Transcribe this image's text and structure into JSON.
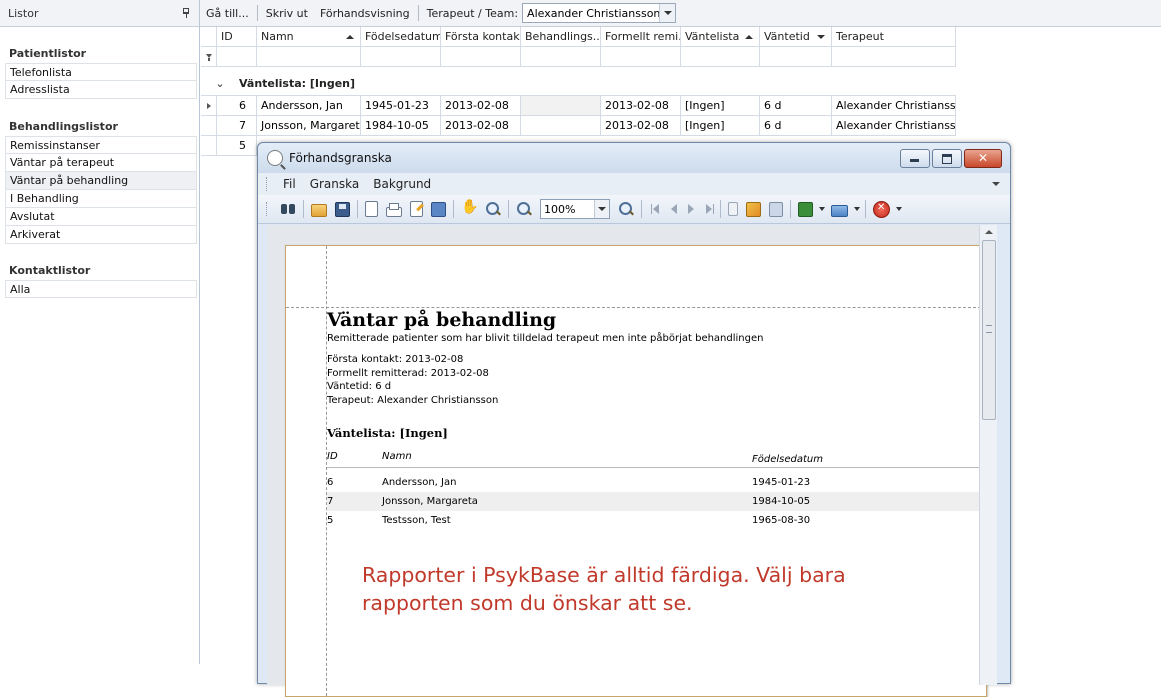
{
  "left_panel": {
    "header": "Listor",
    "groups": [
      {
        "title": "Patientlistor",
        "items": [
          "Telefonlista",
          "Adresslista"
        ]
      },
      {
        "title": "Behandlingslistor",
        "items": [
          "Remissinstanser",
          "Väntar på terapeut",
          "Väntar på behandling",
          "I Behandling",
          "Avslutat",
          "Arkiverat"
        ]
      },
      {
        "title": "Kontaktlistor",
        "items": [
          "Alla"
        ]
      }
    ],
    "selected_item": "Väntar på behandling"
  },
  "toolbar": {
    "goto": "Gå till...",
    "print": "Skriv ut",
    "preview": "Förhandsvisning",
    "therapist_label": "Terapeut / Team:",
    "therapist_value": "Alexander Christiansson"
  },
  "grid": {
    "columns": [
      "ID",
      "Namn",
      "Födelsedatum",
      "Första kontakt",
      "Behandlings...",
      "Formellt remi...",
      "Väntelista",
      "Väntetid",
      "Terapeut"
    ],
    "group_label": "Väntelista: [Ingen]",
    "rows": [
      {
        "id": "6",
        "name": "Andersson, Jan",
        "birth": "1945-01-23",
        "first": "2013-02-08",
        "treat": "",
        "formal": "2013-02-08",
        "wait_list": "[Ingen]",
        "wait_time": "6 d",
        "therapist": "Alexander Christiansson"
      },
      {
        "id": "7",
        "name": "Jonsson, Margareta",
        "birth": "1984-10-05",
        "first": "2013-02-08",
        "treat": "",
        "formal": "2013-02-08",
        "wait_list": "[Ingen]",
        "wait_time": "6 d",
        "therapist": "Alexander Christiansson"
      },
      {
        "id": "5"
      }
    ]
  },
  "dialog": {
    "title": "Förhandsgranska",
    "menu": [
      "Fil",
      "Granska",
      "Bakgrund"
    ],
    "zoom": "100%",
    "close_glyph": "✕",
    "report": {
      "title": "Väntar på behandling",
      "subtitle": "Remitterade patienter som har blivit tilldelad terapeut men inte påbörjat behandlingen",
      "info": [
        "Första kontakt: 2013-02-08",
        "Formellt remitterad: 2013-02-08",
        "Väntetid: 6 d",
        "Terapeut: Alexander Christiansson"
      ],
      "waitlist": "Väntelista: [Ingen]",
      "columns": [
        "ID",
        "Namn",
        "Födelsedatum"
      ],
      "rows": [
        {
          "id": "6",
          "name": "Andersson, Jan",
          "birth": "1945-01-23"
        },
        {
          "id": "7",
          "name": "Jonsson, Margareta",
          "birth": "1984-10-05"
        },
        {
          "id": "5",
          "name": "Testsson, Test",
          "birth": "1965-08-30"
        }
      ]
    },
    "promo_text": "Rapporter i PsykBase är alltid färdiga. Välj bara rapporten som du önskar att se."
  }
}
